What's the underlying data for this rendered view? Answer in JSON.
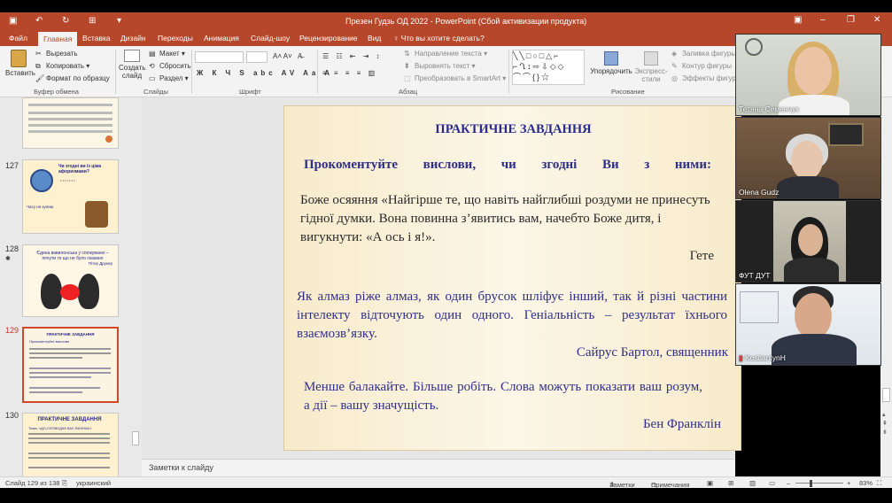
{
  "window": {
    "title": "Презен Гудзь ОД 2022 - PowerPoint (Сбой активизации продукта)"
  },
  "tabs": [
    "Файл",
    "Главная",
    "Вставка",
    "Дизайн",
    "Переходы",
    "Анимация",
    "Слайд-шоу",
    "Рецензирование",
    "Вид"
  ],
  "active_tab": "Главная",
  "tell_me": "Что вы хотите сделать?",
  "ribbon": {
    "paste": "Вставить",
    "cut": "Вырезать",
    "copy": "Копировать",
    "format_painter": "Формат по образцу",
    "group_clipboard": "Буфер обмена",
    "new_slide": "Создать слайд",
    "layout": "Макет",
    "reset": "Сбросить",
    "section": "Раздел",
    "group_slides": "Слайды",
    "group_font": "Шрифт",
    "text_direction": "Направление текста",
    "align_text": "Выровнять текст",
    "convert_smartart": "Преобразовать в SmartArt",
    "group_paragraph": "Абзац",
    "arrange": "Упорядочить",
    "quick_styles": "Экспресс-стили",
    "group_drawing": "Рисование",
    "shape_fill": "Заливка фигуры",
    "shape_outline": "Контур фигуры",
    "shape_effects": "Эффекты фигур"
  },
  "thumbnails": [
    {
      "num": "127",
      "text1": "Чи згодні ви із ціма афоризмами?",
      "text2": "Часу не купиш"
    },
    {
      "num": "128",
      "text1": "Єдина вавилонська у спілкуванні – почути те що не було сказано",
      "text2": "Пітер Друкер"
    },
    {
      "num": "129",
      "text1": "ПРАКТИЧНЕ ЗАВДАННЯ",
      "text2": "Прокоментуйте вислови"
    },
    {
      "num": "130",
      "text1": "ПРАКТИЧНЕ ЗАВДАННЯ",
      "text2": "Тема: «ДО-СЛОВОДАК ВАС ВИЗНАЄ»"
    }
  ],
  "slide": {
    "title": "ПРАКТИЧНЕ ЗАВДАННЯ",
    "subtitle": "Прокоментуйте вислови, чи згодні Ви з ними:",
    "quote1": "Боже осяяння «Найгірше те, що навіть найглибші роздуми не принесуть гідної думки. Вона повинна з’явитись вам, начебто Боже дитя, і вигукнути: «А ось і я!».",
    "author1": "Гете",
    "quote2": "Як алмаз ріже алмаз, як один брусок шліфує інший, так й різні частини інтелекту відточують один одного. Геніальність – результат їхнього взаємозв’язку.",
    "author2": "Сайрус Бартол, священник",
    "quote3": "Менше балакайте. Більше робіть. Слова можуть показати ваш розум, а дії – вашу значущість.",
    "author3": "Бен Франклін"
  },
  "notes_placeholder": "Заметки к слайду",
  "status": {
    "slide_info": "Слайд 129 из 138",
    "language": "украинский",
    "notes": "Заметки",
    "comments": "Примечания",
    "zoom": "83%"
  },
  "participants": [
    {
      "name": "Тетяна Семенчук"
    },
    {
      "name": "Olena Gudz"
    },
    {
      "name": "ФУТ ДУТ"
    },
    {
      "name": "KostiantynH"
    }
  ],
  "colors": {
    "accent": "#b7472a",
    "slide_text": "#2f2f8a"
  }
}
